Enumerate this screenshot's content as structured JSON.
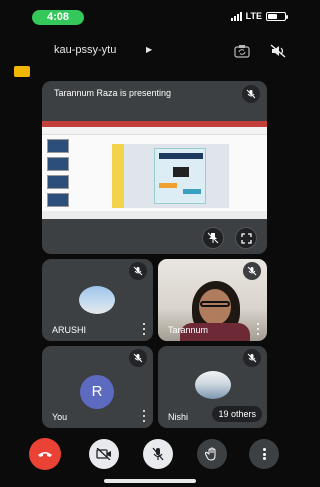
{
  "status_bar": {
    "time": "4:08",
    "network": "LTE",
    "icons": [
      "signal-icon",
      "battery-icon"
    ]
  },
  "meeting": {
    "code": "kau-pssy-ytu",
    "icons": [
      "chevron-right-icon",
      "camera-switch-icon",
      "speaker-off-icon",
      "captions-badge-icon"
    ]
  },
  "presentation": {
    "title": "Tarannum Raza is presenting",
    "icons": [
      "mic-off-icon",
      "pin-off-icon",
      "fullscreen-icon"
    ]
  },
  "participants": [
    {
      "name": "ARUSHI",
      "avatar_type": "photo",
      "muted": true
    },
    {
      "name": "Tarannum",
      "avatar_type": "video",
      "muted": true
    },
    {
      "name": "You",
      "avatar_type": "initial",
      "initial": "R",
      "muted": true
    },
    {
      "name": "Nishi",
      "avatar_type": "photo",
      "muted": true
    }
  ],
  "others_label": "19 others",
  "controls": {
    "icons": [
      "end-call-icon",
      "camera-off-icon",
      "mic-off-icon",
      "raise-hand-icon",
      "more-options-icon"
    ]
  },
  "colors": {
    "end_call": "#ea4335",
    "tile_background": "#3c4043",
    "page_background": "#0b0b0b",
    "status_pill": "#34c759",
    "you_avatar": "#5c6bc0"
  }
}
